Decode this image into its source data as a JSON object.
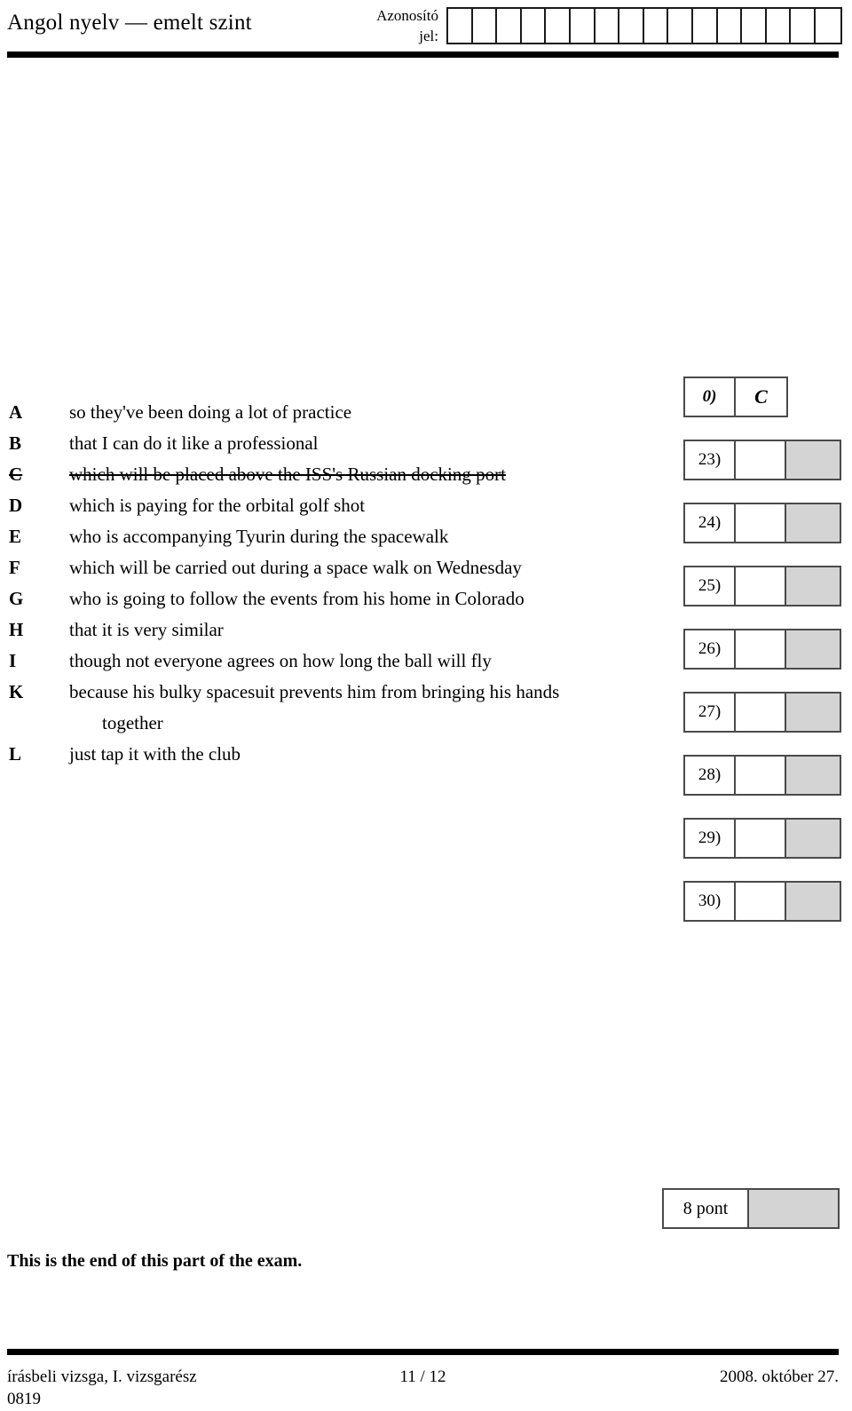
{
  "header": {
    "exam_title": "Angol nyelv — emelt szint",
    "id_label_line1": "Azonosító",
    "id_label_line2": "jel:",
    "id_cell_count": 16
  },
  "options": [
    {
      "letter": "A",
      "text": "so they've been doing a lot of practice",
      "struck": false
    },
    {
      "letter": "B",
      "text": "that I can do it like a professional",
      "struck": false
    },
    {
      "letter": "C",
      "text": "which will be placed above the ISS's Russian docking port",
      "struck": true
    },
    {
      "letter": "D",
      "text": "which is paying for the orbital golf shot",
      "struck": false
    },
    {
      "letter": "E",
      "text": "who is accompanying Tyurin during the spacewalk",
      "struck": false
    },
    {
      "letter": "F",
      "text": "which will be carried out during a space walk on Wednesday",
      "struck": false
    },
    {
      "letter": "G",
      "text": "who is going to follow the events from his home in Colorado",
      "struck": false
    },
    {
      "letter": "H",
      "text": "that it is very similar",
      "struck": false
    },
    {
      "letter": "I",
      "text": "though not everyone agrees on how long the ball will fly",
      "struck": false
    },
    {
      "letter": "K",
      "text": "because his bulky spacesuit prevents him from bringing his hands",
      "struck": false
    },
    {
      "letter": "",
      "text": "together",
      "struck": false,
      "continuation": true
    },
    {
      "letter": "L",
      "text": "just tap it with the club",
      "struck": false
    }
  ],
  "answers": [
    {
      "number": "0)",
      "value": "C",
      "example": true,
      "shaded": false
    },
    {
      "number": "23)",
      "value": "",
      "example": false,
      "shaded": true
    },
    {
      "number": "24)",
      "value": "",
      "example": false,
      "shaded": true
    },
    {
      "number": "25)",
      "value": "",
      "example": false,
      "shaded": true
    },
    {
      "number": "26)",
      "value": "",
      "example": false,
      "shaded": true
    },
    {
      "number": "27)",
      "value": "",
      "example": false,
      "shaded": true
    },
    {
      "number": "28)",
      "value": "",
      "example": false,
      "shaded": true
    },
    {
      "number": "29)",
      "value": "",
      "example": false,
      "shaded": true
    },
    {
      "number": "30)",
      "value": "",
      "example": false,
      "shaded": true
    }
  ],
  "score": {
    "label": "8 pont",
    "value": ""
  },
  "end_note": "This is the end of this part of the exam.",
  "footer": {
    "left_line1": "írásbeli vizsga, I. vizsgarész",
    "left_line2": "0819",
    "center": "11 / 12",
    "right": "2008. október 27."
  },
  "colors": {
    "rule": "#000000",
    "box_border": "#4a4a4a",
    "shaded_cell": "#d4d4d4"
  }
}
